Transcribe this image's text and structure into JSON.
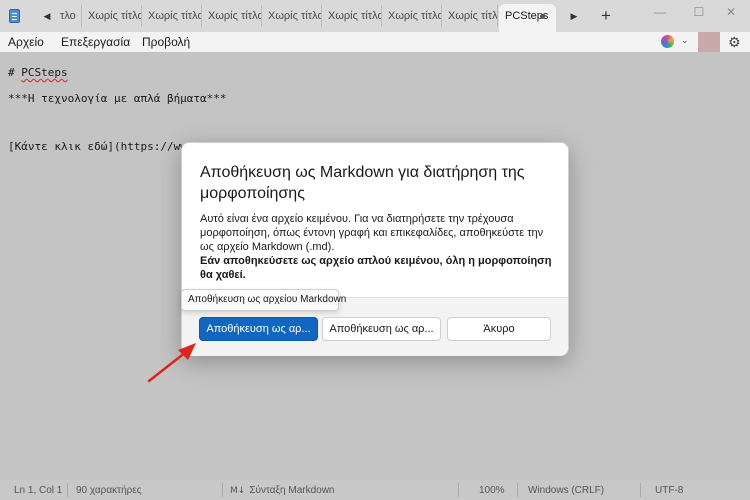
{
  "tabs": [
    {
      "label": "τλο"
    },
    {
      "label": "Χωρίς τίτλο"
    },
    {
      "label": "Χωρίς τίτλο"
    },
    {
      "label": "Χωρίς τίτλο"
    },
    {
      "label": "Χωρίς τίτλο"
    },
    {
      "label": "Χωρίς τίτλο"
    },
    {
      "label": "Χωρίς τίτλο"
    },
    {
      "label": "Χωρίς τίτλο"
    },
    {
      "label": "PCSteps",
      "active": true
    }
  ],
  "icons": {
    "app": "notepad-icon",
    "scroll_left": "◀",
    "scroll_right": "▶",
    "new_tab": "+",
    "minimize": "—",
    "maximize": "☐",
    "close": "✕",
    "chevron": "⌄",
    "gear": "⚙",
    "markdown": "M↓"
  },
  "menu": {
    "file": "Αρχείο",
    "edit": "Επεξεργασία",
    "view": "Προβολή"
  },
  "editor": {
    "line1_prefix": "# ",
    "line1_word": "PCSteps",
    "line2": "***Η τεχνολογία με απλά βήματα***",
    "line3": "[Κάντε κλικ εδώ](https://www."
  },
  "dialog": {
    "title": "Αποθήκευση ως Markdown για διατήρηση της μορφοποίησης",
    "body": "Αυτό είναι ένα αρχείο κειμένου. Για να διατηρήσετε την τρέχουσα μορφοποίηση, όπως έντονη γραφή και επικεφαλίδες, αποθηκεύστε την ως αρχείο Markdown (.md).",
    "body_bold": "Εάν αποθηκεύσετε ως αρχείο απλού κειμένου, όλη η μορφοποίηση θα χαθεί.",
    "primary_button": "Αποθήκευση ως αρ...",
    "secondary_button": "Αποθήκευση ως αρ...",
    "cancel_button": "Άκυρο",
    "tooltip": "Αποθήκευση ως αρχείου Markdown"
  },
  "status": {
    "position": "Ln 1, Col 1",
    "chars": "90 χαρακτήρες",
    "syntax": "Σύνταξη Markdown",
    "zoom": "100%",
    "line_endings": "Windows (CRLF)",
    "encoding": "UTF-8"
  },
  "colors": {
    "accent": "#1167c0",
    "arrow": "#e0231c"
  }
}
